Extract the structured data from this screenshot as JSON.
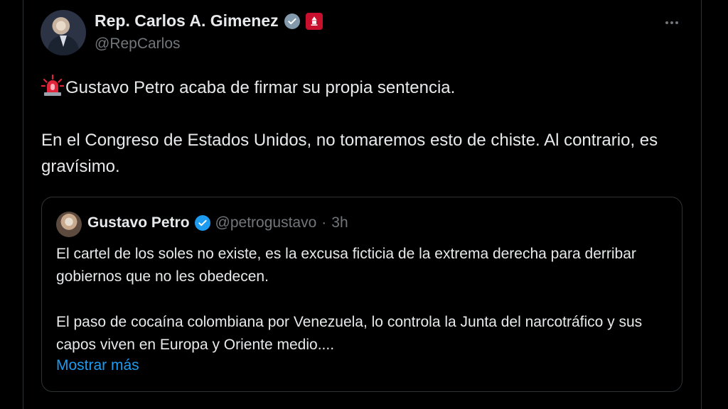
{
  "colors": {
    "background": "#000000",
    "text": "#e7e9ea",
    "muted": "#71767b",
    "link": "#1d9bf0",
    "border": "#2f3336",
    "affiliate_badge": "#c8102e"
  },
  "tweet": {
    "author": {
      "display_name": "Rep. Carlos A. Gimenez",
      "handle": "@RepCarlos",
      "verified_icon": "gray-checkmark-badge",
      "affiliation_icon": "congress-seal-badge"
    },
    "text": {
      "emoji": "rotating-light-siren",
      "line1": "Gustavo Petro acaba de firmar su propia sentencia.",
      "line2": "En el Congreso de Estados Unidos, no tomaremos esto de chiste. Al contrario, es gravísimo."
    },
    "more_icon": "more-horizontal-icon"
  },
  "quote": {
    "author": {
      "display_name": "Gustavo Petro",
      "handle": "@petrogustavo",
      "separator": "·",
      "time": "3h",
      "verified_icon": "blue-checkmark-badge"
    },
    "paragraph1": "El cartel de los soles no existe, es la excusa ficticia de la extrema derecha para derribar gobiernos que no les obedecen.",
    "paragraph2": "El paso de cocaína colombiana por Venezuela, lo controla la Junta del narcotráfico y sus capos viven en Europa y Oriente medio....",
    "show_more": "Mostrar más"
  }
}
